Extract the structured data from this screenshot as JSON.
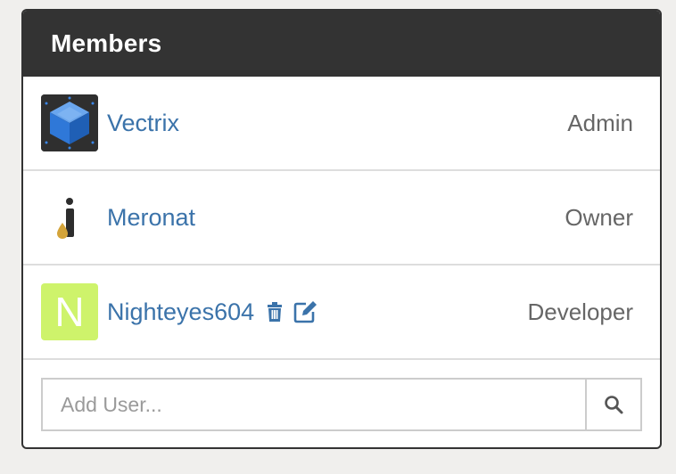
{
  "panel": {
    "title": "Members"
  },
  "members": [
    {
      "name": "Vectrix",
      "role": "Admin",
      "avatar": "cube-avatar"
    },
    {
      "name": "Meronat",
      "role": "Owner",
      "avatar": "info-drop-avatar"
    },
    {
      "name": "Nighteyes604",
      "role": "Developer",
      "avatar": "letter-avatar",
      "avatar_letter": "N",
      "avatar_color": "#cef36b",
      "actions": [
        "trash-icon",
        "edit-icon"
      ]
    }
  ],
  "add_user": {
    "placeholder": "Add User...",
    "button_icon": "search-icon"
  },
  "colors": {
    "header_bg": "#333333",
    "link": "#3b73aa",
    "role_text": "#666666",
    "border": "#dddddd"
  }
}
